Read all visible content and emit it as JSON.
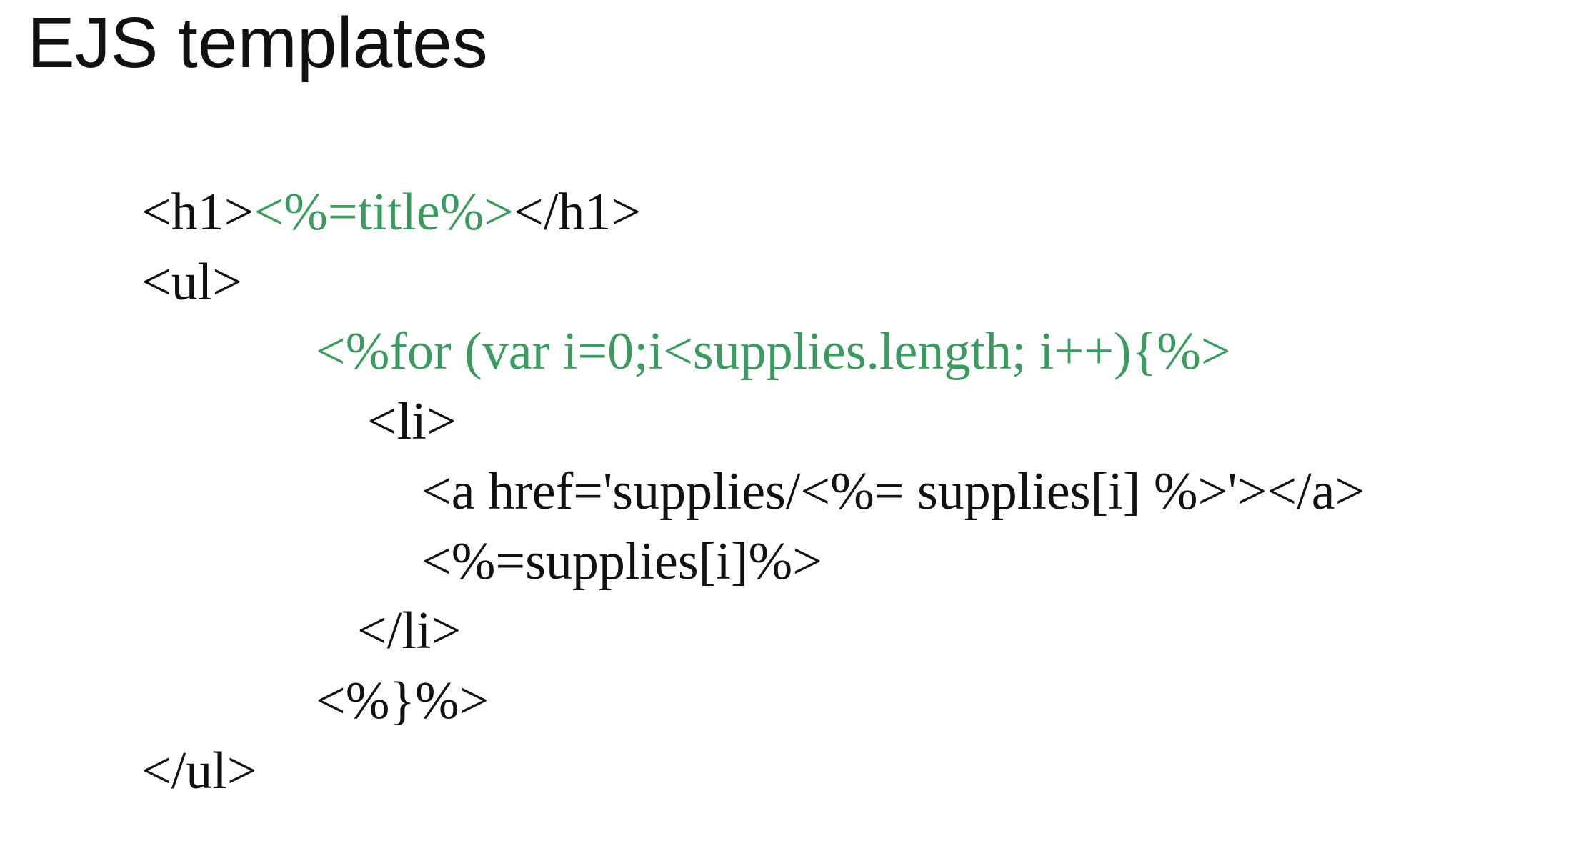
{
  "slide": {
    "title": "EJS templates"
  },
  "code": {
    "line1": {
      "open": "<h1>",
      "expr": "<%=title%>",
      "close": "</h1>"
    },
    "line2": "<ul>",
    "line3": "<%for (var i=0;i<supplies.length; i++){%>",
    "line4": "<li>",
    "line5": "<a href='supplies/<%= supplies[i] %>'></a>",
    "line6": "<%=supplies[i]%>",
    "line7": "</li>",
    "line8": "<%}%>",
    "line9": "</ul>"
  },
  "colors": {
    "text": "#111111",
    "ejs_highlight": "#3b9a5d",
    "background": "#ffffff"
  }
}
